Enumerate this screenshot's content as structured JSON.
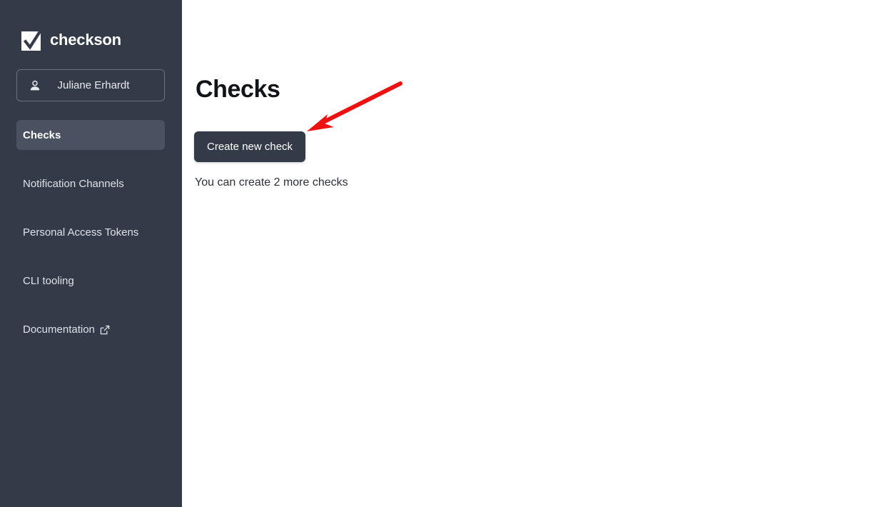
{
  "brand": {
    "name": "checkson",
    "logo_icon": "checkmark-square-icon"
  },
  "sidebar": {
    "background_color": "#343b48",
    "user": {
      "name": "Juliane Erhardt",
      "icon": "person-icon"
    },
    "items": [
      {
        "label": "Checks",
        "active": true,
        "icon": null
      },
      {
        "label": "Notification Channels",
        "active": false,
        "icon": null
      },
      {
        "label": "Personal Access Tokens",
        "active": false,
        "icon": null
      },
      {
        "label": "CLI tooling",
        "active": false,
        "icon": null
      },
      {
        "label": "Documentation",
        "active": false,
        "icon": "external-link-icon"
      }
    ],
    "active_item_color": "#4a5160"
  },
  "main": {
    "title": "Checks",
    "create_button_label": "Create new check",
    "create_button_color": "#333b48",
    "quota_text": "You can create 2 more checks"
  },
  "annotation": {
    "arrow_color": "#ee1111",
    "arrow_name": "red-pointer-arrow",
    "points_to": "Create new check"
  }
}
